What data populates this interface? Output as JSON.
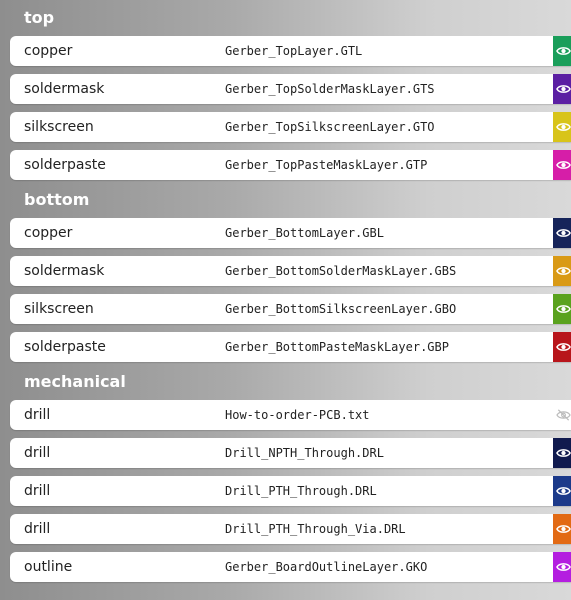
{
  "sections": [
    {
      "title": "top",
      "rows": [
        {
          "layer": "copper",
          "file": "Gerber_TopLayer.GTL",
          "color": "#1a9e5a",
          "visible": true
        },
        {
          "layer": "soldermask",
          "file": "Gerber_TopSolderMaskLayer.GTS",
          "color": "#5b1fa3",
          "visible": true
        },
        {
          "layer": "silkscreen",
          "file": "Gerber_TopSilkscreenLayer.GTO",
          "color": "#d8c41a",
          "visible": true
        },
        {
          "layer": "solderpaste",
          "file": "Gerber_TopPasteMaskLayer.GTP",
          "color": "#d61ea8",
          "visible": true
        }
      ]
    },
    {
      "title": "bottom",
      "rows": [
        {
          "layer": "copper",
          "file": "Gerber_BottomLayer.GBL",
          "color": "#16245a",
          "visible": true
        },
        {
          "layer": "soldermask",
          "file": "Gerber_BottomSolderMaskLayer.GBS",
          "color": "#d99a16",
          "visible": true
        },
        {
          "layer": "silkscreen",
          "file": "Gerber_BottomSilkscreenLayer.GBO",
          "color": "#5aa21e",
          "visible": true
        },
        {
          "layer": "solderpaste",
          "file": "Gerber_BottomPasteMaskLayer.GBP",
          "color": "#b8151b",
          "visible": true
        }
      ]
    },
    {
      "title": "mechanical",
      "rows": [
        {
          "layer": "drill",
          "file": "How-to-order-PCB.txt",
          "color": "#ffffff",
          "visible": false
        },
        {
          "layer": "drill",
          "file": "Drill_NPTH_Through.DRL",
          "color": "#101a4e",
          "visible": true
        },
        {
          "layer": "drill",
          "file": "Drill_PTH_Through.DRL",
          "color": "#1c3a8a",
          "visible": true
        },
        {
          "layer": "drill",
          "file": "Drill_PTH_Through_Via.DRL",
          "color": "#e26a14",
          "visible": true
        },
        {
          "layer": "outline",
          "file": "Gerber_BoardOutlineLayer.GKO",
          "color": "#b41ee0",
          "visible": true
        }
      ]
    }
  ],
  "icons": {
    "visible": "eye-icon",
    "hidden": "eye-off-icon"
  }
}
